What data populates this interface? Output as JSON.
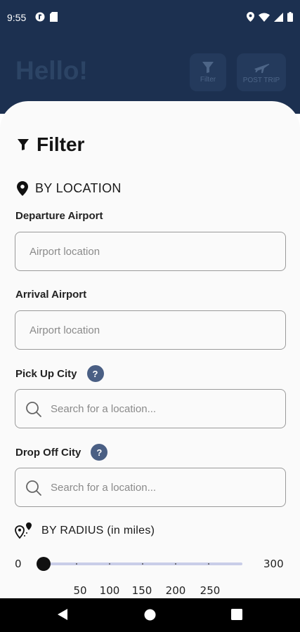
{
  "status_bar": {
    "time": "9:55"
  },
  "header": {
    "greeting": "Hello!",
    "filter_label": "Filter",
    "post_trip_label": "POST TRIP"
  },
  "filter_panel": {
    "title": "Filter",
    "by_location": "BY LOCATION",
    "departure": {
      "label": "Departure Airport",
      "placeholder": "Airport location",
      "value": ""
    },
    "arrival": {
      "label": "Arrival Airport",
      "placeholder": "Airport location",
      "value": ""
    },
    "pickup": {
      "label": "Pick Up City",
      "help": "?",
      "placeholder": "Search for a location...",
      "value": ""
    },
    "dropoff": {
      "label": "Drop Off City",
      "help": "?",
      "placeholder": "Search for a location...",
      "value": ""
    },
    "by_radius": "BY RADIUS (in miles)",
    "radius": {
      "min": "0",
      "max": "300",
      "current": 0,
      "ticks": [
        "50",
        "100",
        "150",
        "200",
        "250"
      ]
    }
  },
  "colors": {
    "header_bg": "#1c3050",
    "help_badge": "#4a5f84",
    "slider_track": "#c9cde8"
  }
}
